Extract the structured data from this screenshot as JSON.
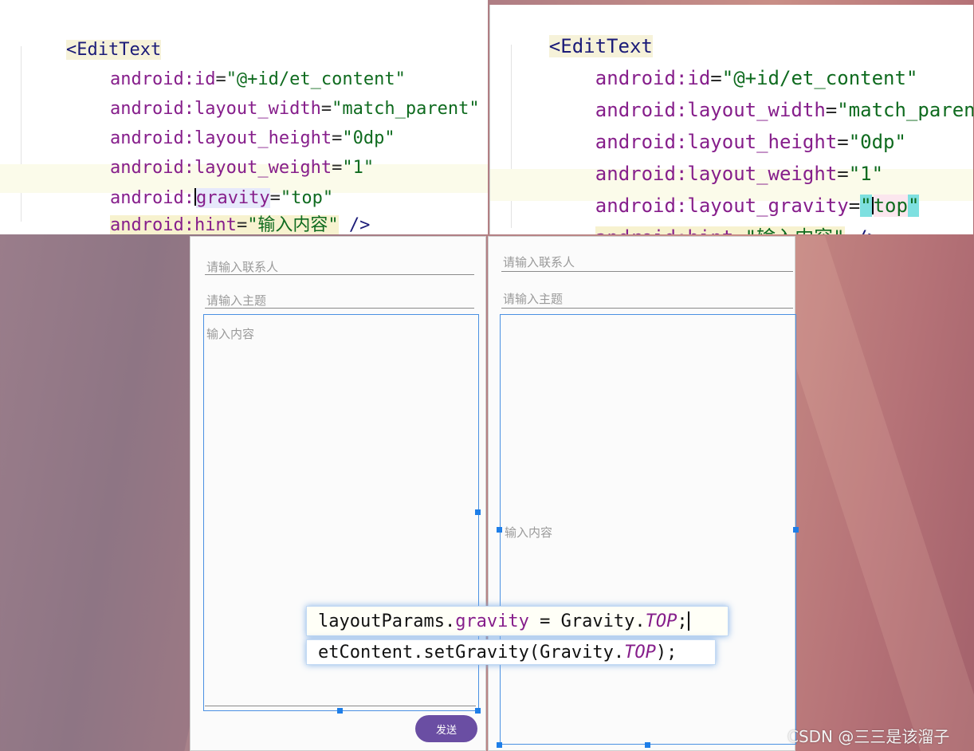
{
  "left_code": {
    "tag_open": "<EditText",
    "lines": [
      {
        "attr": "android:id",
        "eq": "=",
        "value": "\"@+id/et_content\""
      },
      {
        "attr": "android:layout_width",
        "eq": "=",
        "value": "\"match_parent\""
      },
      {
        "attr": "android:layout_height",
        "eq": "=",
        "value": "\"0dp\""
      },
      {
        "attr": "android:layout_weight",
        "eq": "=",
        "value": "\"1\""
      },
      {
        "attr_ns": "android:",
        "attr_name": "gravity",
        "eq": "=",
        "value": "\"top\""
      },
      {
        "attr": "android:hint",
        "eq": "=",
        "value": "\"输入内容\"",
        "close": " />"
      }
    ]
  },
  "right_code": {
    "tag_open": "<EditText",
    "lines": [
      {
        "attr": "android:id",
        "eq": "=",
        "value": "\"@+id/et_content\""
      },
      {
        "attr": "android:layout_width",
        "eq": "=",
        "value": "\"match_parent\""
      },
      {
        "attr": "android:layout_height",
        "eq": "=",
        "value": "\"0dp\""
      },
      {
        "attr": "android:layout_weight",
        "eq": "=",
        "value": "\"1\""
      },
      {
        "attr": "android:layout_gravity",
        "eq": "=",
        "value_quote": "\"",
        "value_text": "top",
        "value_end": "\""
      },
      {
        "attr": "android:hint",
        "eq": "=",
        "value": "\"输入内容\"",
        "close": " />"
      }
    ]
  },
  "left_screen": {
    "contact_hint": "请输入联系人",
    "subject_hint": "请输入主题",
    "content_hint": "输入内容",
    "send_label": "发送"
  },
  "right_screen": {
    "contact_hint": "请输入联系人",
    "subject_hint": "请输入主题",
    "content_hint": "输入内容"
  },
  "snippet": {
    "line1_obj": "layoutParams.",
    "line1_field": "gravity",
    "line1_mid": " = Gravity.",
    "line1_const": "TOP",
    "line1_end": ";",
    "line2_pre": "etContent.setGravity(Gravity.",
    "line2_const": "TOP",
    "line2_end": ");"
  },
  "watermark": "CSDN @三三是该溜子"
}
